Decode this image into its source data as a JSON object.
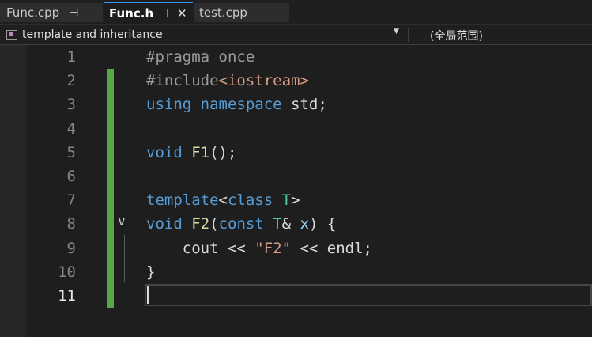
{
  "tabs": [
    {
      "label": "Func.cpp",
      "pin": "⊣",
      "active": false
    },
    {
      "label": "Func.h",
      "pin": "⊣",
      "close": "✕",
      "active": true
    },
    {
      "label": "test.cpp",
      "active": false
    }
  ],
  "navbar": {
    "scope": "template and inheritance",
    "scope_icon": "class-scope-icon",
    "dropdown_icon": "chevron-down-icon",
    "member": "(全局范围)"
  },
  "editor": {
    "line_numbers": [
      "1",
      "2",
      "3",
      "4",
      "5",
      "6",
      "7",
      "8",
      "9",
      "10",
      "11"
    ],
    "current_line": 11,
    "lines": [
      [
        {
          "t": "#pragma once",
          "c": "pp"
        }
      ],
      [
        {
          "t": "#include",
          "c": "pp"
        },
        {
          "t": "<iostream>",
          "c": "str"
        }
      ],
      [
        {
          "t": "using",
          "c": "kw"
        },
        {
          "t": " ",
          "c": "plain"
        },
        {
          "t": "namespace",
          "c": "kw"
        },
        {
          "t": " std;",
          "c": "plain"
        }
      ],
      [],
      [
        {
          "t": "void",
          "c": "kw"
        },
        {
          "t": " ",
          "c": "plain"
        },
        {
          "t": "F1",
          "c": "fn"
        },
        {
          "t": "();",
          "c": "plain"
        }
      ],
      [],
      [
        {
          "t": "template",
          "c": "kw"
        },
        {
          "t": "<",
          "c": "plain"
        },
        {
          "t": "class",
          "c": "kw"
        },
        {
          "t": " ",
          "c": "plain"
        },
        {
          "t": "T",
          "c": "tp"
        },
        {
          "t": ">",
          "c": "plain"
        }
      ],
      [
        {
          "t": "void",
          "c": "kw"
        },
        {
          "t": " ",
          "c": "plain"
        },
        {
          "t": "F2",
          "c": "fn"
        },
        {
          "t": "(",
          "c": "plain"
        },
        {
          "t": "const",
          "c": "kw"
        },
        {
          "t": " ",
          "c": "plain"
        },
        {
          "t": "T",
          "c": "tp"
        },
        {
          "t": "& ",
          "c": "plain"
        },
        {
          "t": "x",
          "c": "var"
        },
        {
          "t": ") {",
          "c": "plain"
        }
      ],
      [
        {
          "t": "    cout << ",
          "c": "plain"
        },
        {
          "t": "\"F2\"",
          "c": "str"
        },
        {
          "t": " << endl;",
          "c": "plain"
        }
      ],
      [
        {
          "t": "}",
          "c": "plain"
        }
      ],
      []
    ]
  },
  "colors": {
    "change_bar": "#57a64a",
    "keyword": "#569cd6",
    "string": "#d69d85",
    "type": "#4ec9b0",
    "function": "#dcdcaa"
  }
}
